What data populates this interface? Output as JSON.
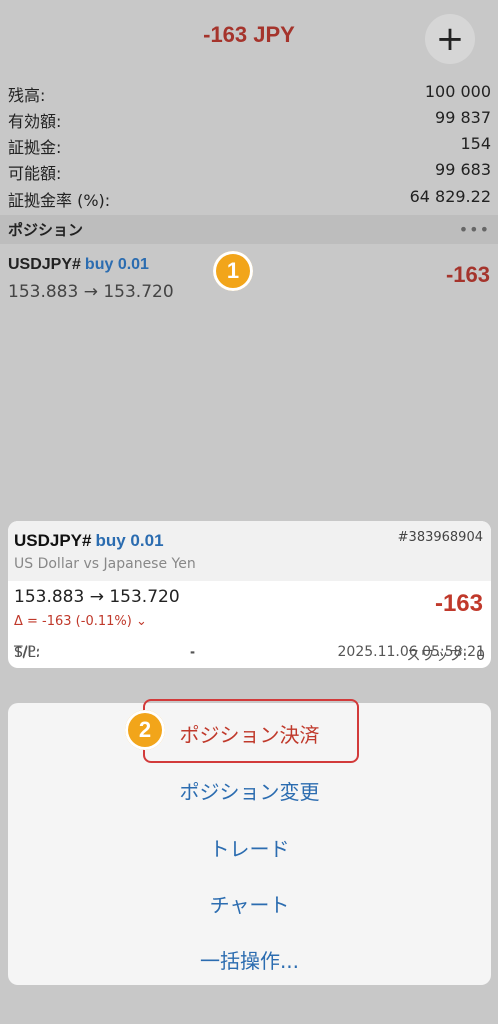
{
  "header": {
    "title": "-163 JPY",
    "add_icon": "+"
  },
  "summary": [
    {
      "label": "残高:",
      "value": "100 000"
    },
    {
      "label": "有効額:",
      "value": "99 837"
    },
    {
      "label": "証拠金:",
      "value": "154"
    },
    {
      "label": "可能額:",
      "value": "99 683"
    },
    {
      "label": "証拠金率 (%):",
      "value": "64 829.22"
    }
  ],
  "positions_section": {
    "title": "ポジション",
    "more_icon": "•••"
  },
  "position": {
    "symbol": "USDJPY#",
    "side": "buy 0.01",
    "prices": "153.883 → 153.720",
    "profit": "-163"
  },
  "badges": {
    "one": "1",
    "two": "2"
  },
  "detail_card": {
    "symbol": "USDJPY#",
    "side": "buy 0.01",
    "ticket": "#383968904",
    "description": "US Dollar vs Japanese Yen",
    "prices": "153.883 → 153.720",
    "delta": "Δ = -163 (-0.11%) ⌄",
    "profit": "-163",
    "sl_label": "S/L:",
    "sl_value": "-",
    "swap_label": "スワップ:",
    "swap_value": "0",
    "tp_label": "T/P:",
    "tp_value": "-",
    "time": "2025.11.06 05:58:21"
  },
  "action_sheet": {
    "close": "ポジション決済",
    "modify": "ポジション変更",
    "trade": "トレード",
    "chart": "チャート",
    "bulk": "一括操作..."
  },
  "colors": {
    "loss": "#c0392b",
    "accent": "#2b6cb0",
    "badge": "#f2a51a",
    "highlight": "#d23a3a"
  }
}
